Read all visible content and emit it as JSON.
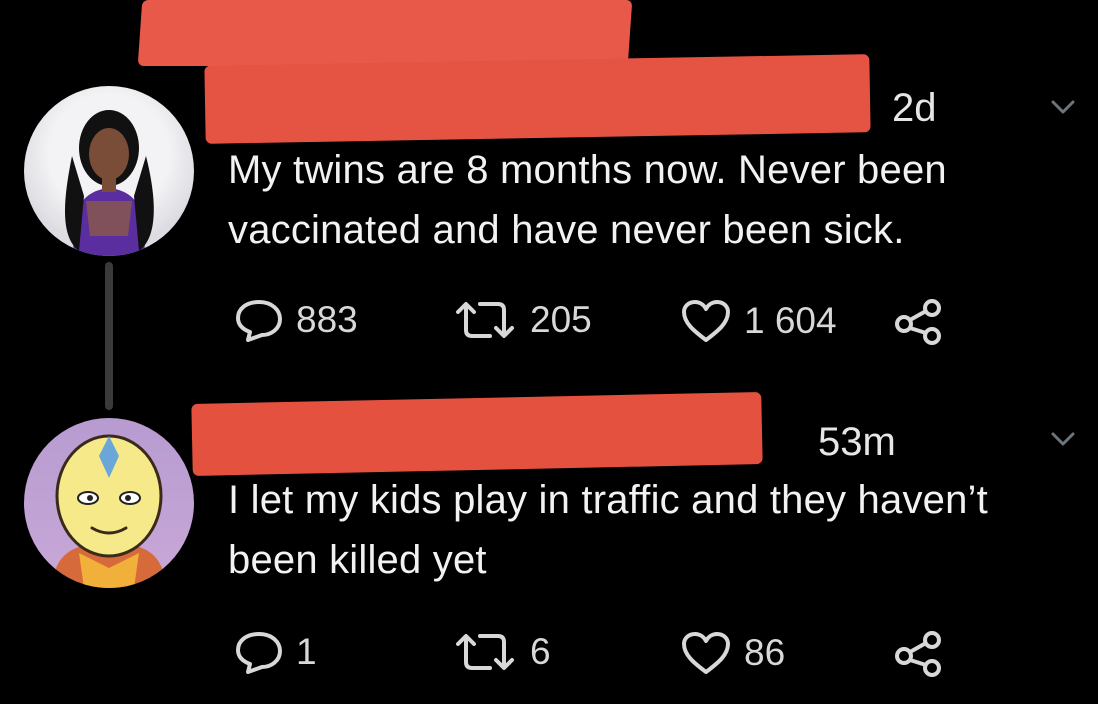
{
  "tweets": [
    {
      "time": "2d",
      "text": "My twins are 8 months now. Never been vaccinated and have never been sick.",
      "counts": {
        "replies": "883",
        "retweets": "205",
        "likes": "1 604"
      }
    },
    {
      "time": "53m",
      "text": "I let my kids play in traffic and they haven’t been killed yet",
      "counts": {
        "replies": "1",
        "retweets": "6",
        "likes": "86"
      }
    }
  ],
  "icons": {
    "reply": "reply-icon",
    "retweet": "retweet-icon",
    "like": "heart-icon",
    "share": "share-icon",
    "more": "chevron-down-icon"
  },
  "colors": {
    "background": "#000000",
    "text": "#e6e6e6",
    "redaction": "#e55443",
    "thread_line": "#3a3a3a"
  }
}
